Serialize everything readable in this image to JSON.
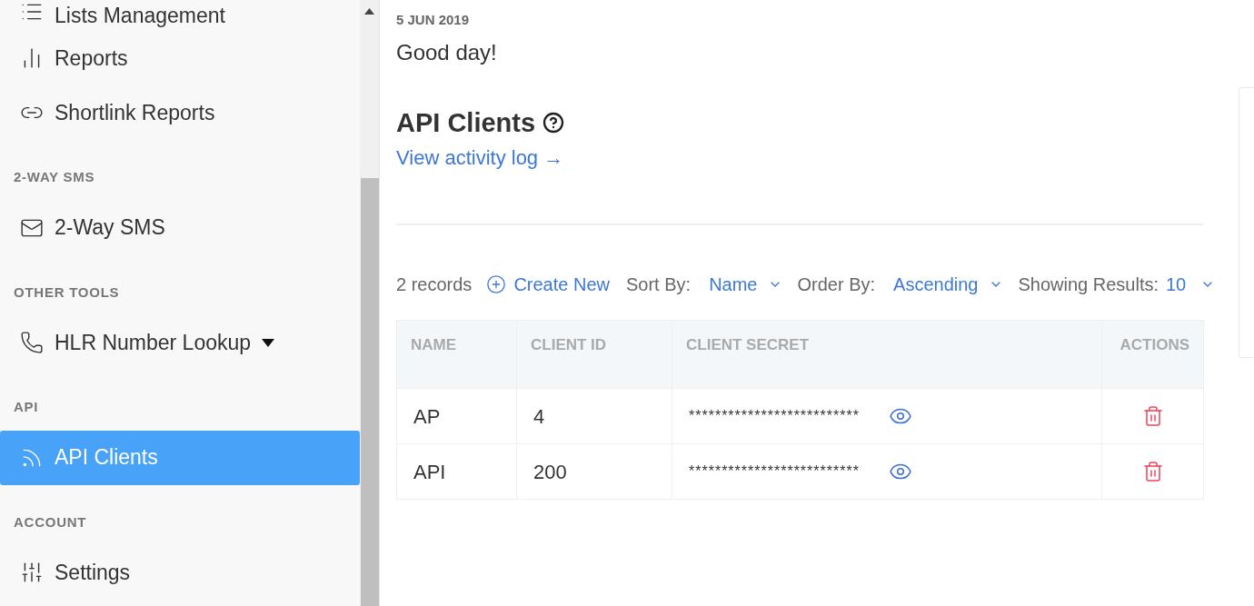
{
  "sidebar": {
    "sections": [
      {
        "items": [
          {
            "label": "Lists Management",
            "selected": false,
            "expandable": false
          },
          {
            "label": "Reports",
            "selected": false,
            "expandable": false
          },
          {
            "label": "Shortlink Reports",
            "selected": false,
            "expandable": false
          }
        ]
      },
      {
        "heading": "2-WAY SMS",
        "items": [
          {
            "label": "2-Way SMS",
            "selected": false,
            "expandable": false
          }
        ]
      },
      {
        "heading": "OTHER TOOLS",
        "items": [
          {
            "label": "HLR Number Lookup",
            "selected": false,
            "expandable": true
          }
        ]
      },
      {
        "heading": "API",
        "items": [
          {
            "label": "API Clients",
            "selected": true,
            "expandable": false
          }
        ]
      },
      {
        "heading": "ACCOUNT",
        "items": [
          {
            "label": "Settings",
            "selected": false,
            "expandable": false
          }
        ]
      }
    ]
  },
  "main": {
    "date": "5 JUN 2019",
    "greeting": "Good day!",
    "title": "API Clients",
    "activity_link": "View activity log →",
    "toolbar": {
      "records": "2 records",
      "create": "Create New",
      "sort_label": "Sort By:",
      "sort_value": "Name",
      "order_label": "Order By:",
      "order_value": "Ascending",
      "results_label": "Showing Results:",
      "results_value": "10"
    },
    "table": {
      "columns": [
        "NAME",
        "CLIENT ID",
        "CLIENT SECRET",
        "ACTIONS"
      ],
      "rows": [
        {
          "name": "AP",
          "client_id": "4",
          "secret": "**************************"
        },
        {
          "name": "API",
          "client_id": "200",
          "secret": "**************************"
        }
      ]
    }
  }
}
